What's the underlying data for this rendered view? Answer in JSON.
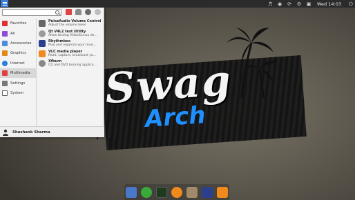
{
  "top_panel": {
    "clock": "Wed 14:03",
    "tray_icons": [
      "volume-icon",
      "network-icon",
      "update-icon",
      "settings-icon",
      "monitor-icon",
      "power-icon"
    ]
  },
  "menu": {
    "search": {
      "placeholder": "",
      "value": ""
    },
    "header_actions": [
      "applications-icon",
      "lock-icon",
      "user-icon",
      "power-icon"
    ],
    "categories": [
      {
        "label": "Favorites",
        "icon": "favorites-icon",
        "color": "#d33"
      },
      {
        "label": "All",
        "icon": "all-apps-icon",
        "color": "#8a4bd6"
      },
      {
        "label": "Accessories",
        "icon": "accessories-icon",
        "color": "#4a90d9"
      },
      {
        "label": "Graphics",
        "icon": "graphics-icon",
        "color": "#e08a1e"
      },
      {
        "label": "Internet",
        "icon": "internet-icon",
        "color": "#2a7fd4"
      },
      {
        "label": "Multimedia",
        "icon": "multimedia-icon",
        "color": "#e04040"
      },
      {
        "label": "Settings",
        "icon": "settings-icon",
        "color": "#777777"
      },
      {
        "label": "System",
        "icon": "system-icon",
        "color": "#666666"
      }
    ],
    "active_category": "Multimedia",
    "apps": [
      {
        "name": "PulseAudio Volume Control",
        "desc": "Adjust the volume level",
        "icon": "pavucontrol-icon",
        "color": "#666666"
      },
      {
        "name": "Qt V4L2 test Utility",
        "desc": "Allow testing Video4Linux de...",
        "icon": "qv4l2-icon",
        "color": "#9a9a9a"
      },
      {
        "name": "Rhythmbox",
        "desc": "Play and organize your musi...",
        "icon": "rhythmbox-icon",
        "color": "#2b3f8f"
      },
      {
        "name": "VLC media player",
        "desc": "Read, capture, broadcast yo...",
        "icon": "vlc-icon",
        "color": "#f08a1c"
      },
      {
        "name": "Xfburn",
        "desc": "CD and DVD burning applica...",
        "icon": "xfburn-icon",
        "color": "#888888"
      }
    ],
    "user": {
      "name": "Shashank Sharma",
      "icon": "user-avatar-icon"
    }
  },
  "dock": {
    "items": [
      {
        "icon": "files-icon",
        "color": "#4a78c8"
      },
      {
        "icon": "keys-icon",
        "color": "#3aaa3a"
      },
      {
        "icon": "system-monitor-icon",
        "color": "#1e3a1e"
      },
      {
        "icon": "browser-icon",
        "color": "#f08a1c"
      },
      {
        "icon": "archive-icon",
        "color": "#a08a6a"
      },
      {
        "icon": "music-player-icon",
        "color": "#2b3f8f"
      },
      {
        "icon": "media-player-icon",
        "color": "#f08a1c"
      }
    ]
  },
  "wallpaper": {
    "title": "Swag",
    "subtitle": "Arch",
    "accent": "#1e90ff"
  }
}
